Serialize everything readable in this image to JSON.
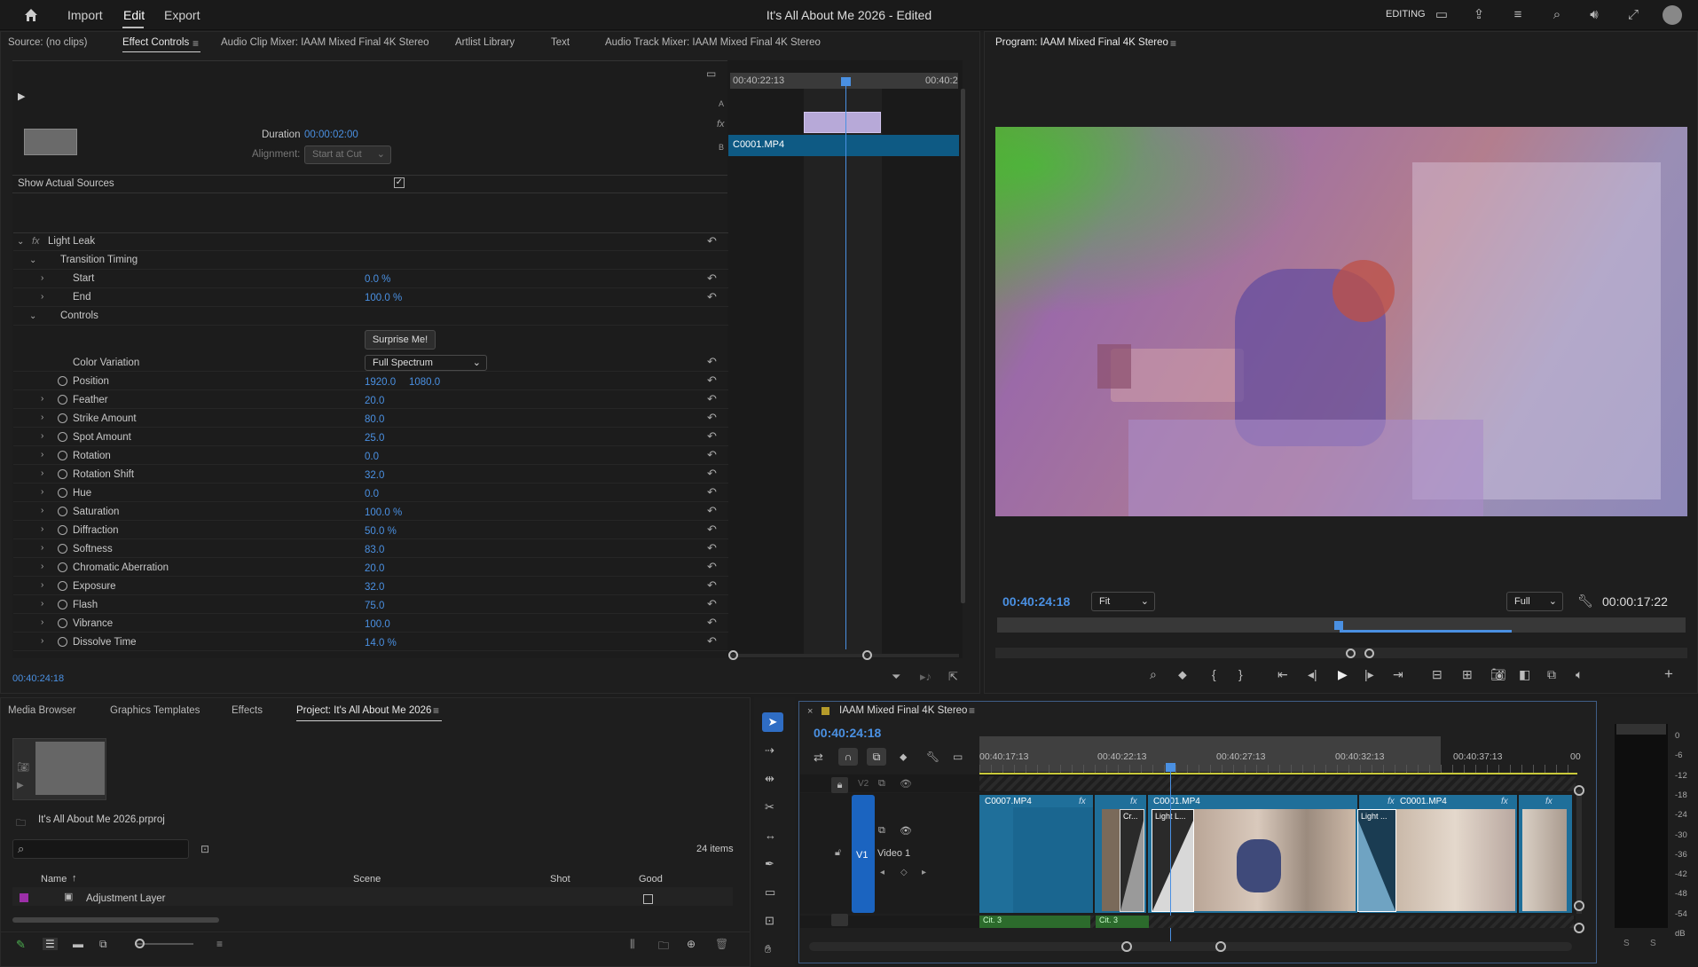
{
  "header": {
    "menu_import": "Import",
    "menu_edit": "Edit",
    "menu_export": "Export",
    "title": "It's All About Me 2026 - Edited",
    "workspace": "EDITING"
  },
  "source_panel": {
    "tab_source": "Source: (no clips)",
    "tab_effect_controls": "Effect Controls",
    "tab_audio_clip_mixer": "Audio Clip Mixer: IAAM  Mixed Final 4K Stereo",
    "tab_artlist": "Artlist Library",
    "tab_text": "Text",
    "tab_audio_track_mixer": "Audio Track Mixer: IAAM  Mixed Final 4K Stereo"
  },
  "effect_controls": {
    "mini_timecode_left": "00:40:22:13",
    "mini_timecode_right": "00:40:2",
    "track_a": "A",
    "track_b": "B",
    "clip_name": "C0001.MP4",
    "duration_label": "Duration",
    "duration_value": "00:00:02:00",
    "alignment_label": "Alignment:",
    "alignment_value": "Start at Cut",
    "show_actual_sources": "Show Actual Sources",
    "effect_name": "Light Leak",
    "group_transition_timing": "Transition Timing",
    "start_label": "Start",
    "start_value": "0.0 %",
    "end_label": "End",
    "end_value": "100.0 %",
    "group_controls": "Controls",
    "surprise_button": "Surprise Me!",
    "color_variation_label": "Color Variation",
    "color_variation_value": "Full Spectrum",
    "position_label": "Position",
    "position_x": "1920.0",
    "position_y": "1080.0",
    "params": [
      {
        "label": "Feather",
        "value": "20.0"
      },
      {
        "label": "Strike Amount",
        "value": "80.0"
      },
      {
        "label": "Spot Amount",
        "value": "25.0"
      },
      {
        "label": "Rotation",
        "value": "0.0"
      },
      {
        "label": "Rotation Shift",
        "value": "32.0"
      },
      {
        "label": "Hue",
        "value": "0.0"
      },
      {
        "label": "Saturation",
        "value": "100.0 %"
      },
      {
        "label": "Diffraction",
        "value": "50.0 %"
      },
      {
        "label": "Softness",
        "value": "83.0"
      },
      {
        "label": "Chromatic Aberration",
        "value": "20.0"
      },
      {
        "label": "Exposure",
        "value": "32.0"
      },
      {
        "label": "Flash",
        "value": "75.0"
      },
      {
        "label": "Vibrance",
        "value": "100.0"
      },
      {
        "label": "Dissolve Time",
        "value": "14.0 %"
      }
    ],
    "timecode": "00:40:24:18"
  },
  "program": {
    "tab": "Program: IAAM  Mixed Final 4K Stereo",
    "timecode": "00:40:24:18",
    "fit": "Fit",
    "quality": "Full",
    "duration": "00:00:17:22"
  },
  "project_panel": {
    "tab_media_browser": "Media Browser",
    "tab_graphics": "Graphics Templates",
    "tab_effects": "Effects",
    "tab_project": "Project: It's All About Me 2026",
    "project_file": "It's All About Me 2026.prproj",
    "items_count": "24 items",
    "col_name": "Name",
    "col_scene": "Scene",
    "col_shot": "Shot",
    "col_good": "Good",
    "item1": "Adjustment Layer"
  },
  "timeline": {
    "sequence_tab": "IAAM  Mixed Final 4K Stereo",
    "timecode": "00:40:24:18",
    "ruler": [
      "00:40:17:13",
      "00:40:22:13",
      "00:40:27:13",
      "00:40:32:13",
      "00:40:37:13",
      "00"
    ],
    "v2": "V2",
    "v1": "V1",
    "video1": "Video 1",
    "clip1": "C0007.MP4",
    "clip2": "C0001.MP4",
    "clip3": "C0001.MP4",
    "trans1": "Cr...",
    "trans2": "Light L...",
    "trans3": "Light ...",
    "audio1": "Cit. 3",
    "audio2": "Cit. 3"
  },
  "meter": {
    "scale": [
      "0",
      "-6",
      "-12",
      "-18",
      "-24",
      "-30",
      "-36",
      "-42",
      "-48",
      "-54",
      "dB"
    ],
    "s1": "S",
    "s2": "S"
  },
  "colors": {
    "accent": "#4a90e2",
    "clip_blue": "#1f6f9a",
    "purple": "#9c2fa8"
  }
}
